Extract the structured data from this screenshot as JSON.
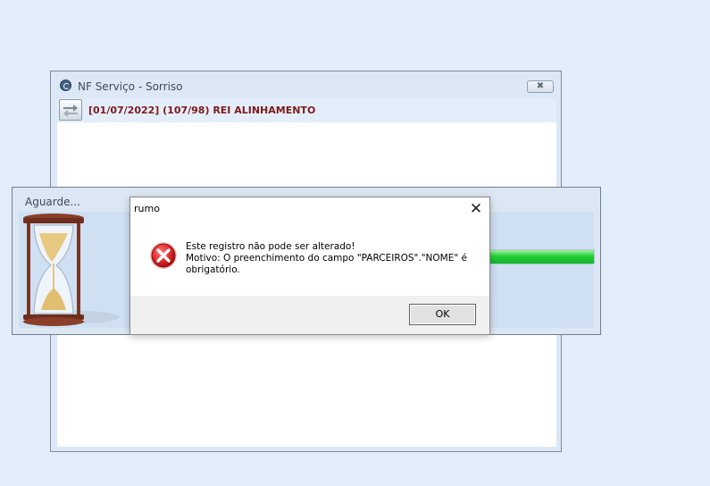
{
  "nf_window": {
    "title": "NF Serviço - Sorriso",
    "close_label": "✖",
    "record_label": "[01/07/2022] (107/98) REI ALINHAMENTO",
    "app_icon": "app-logo-icon",
    "swap_icon": "swap-arrows-icon"
  },
  "wait_window": {
    "title": "Aguarde...",
    "progress": 1.0,
    "icon": "hourglass-icon"
  },
  "dialog": {
    "title": "rumo",
    "close_label": "✕",
    "icon": "error-icon",
    "message_line1": "Este registro não pode ser alterado!",
    "message_line2": "Motivo: O preenchimento do campo \"PARCEIROS\".\"NOME\" é",
    "message_line3": "obrigatório.",
    "ok_label": "OK"
  },
  "colors": {
    "desktop": "#e3eefb",
    "record_text": "#7c1b1b",
    "progress": "#13b32a",
    "error_red": "#d62a2a"
  }
}
